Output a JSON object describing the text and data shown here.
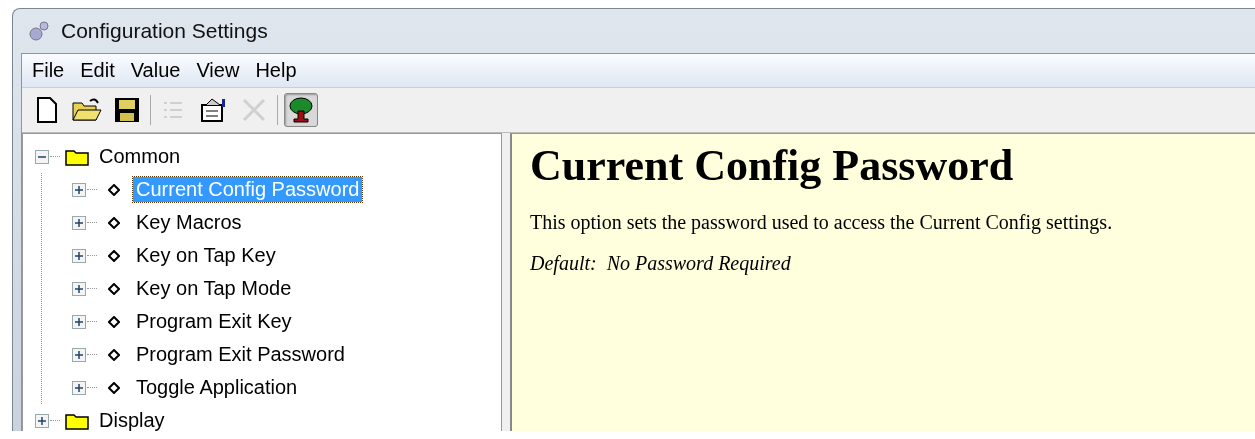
{
  "window": {
    "title": "Configuration Settings"
  },
  "menu": [
    "File",
    "Edit",
    "Value",
    "View",
    "Help"
  ],
  "toolbar": [
    {
      "kind": "new",
      "disabled": false,
      "pressed": false
    },
    {
      "kind": "open",
      "disabled": false,
      "pressed": false
    },
    {
      "kind": "save",
      "disabled": false,
      "pressed": false
    },
    {
      "kind": "separator"
    },
    {
      "kind": "list",
      "disabled": true,
      "pressed": false
    },
    {
      "kind": "properties",
      "disabled": false,
      "pressed": false
    },
    {
      "kind": "delete",
      "disabled": true,
      "pressed": false
    },
    {
      "kind": "separator"
    },
    {
      "kind": "tree",
      "disabled": false,
      "pressed": true
    }
  ],
  "tree": [
    {
      "label": "Common",
      "kind": "folder",
      "expanded": true,
      "selected": false,
      "children": [
        {
          "label": "Current Config Password",
          "kind": "setting",
          "expanded": false,
          "selected": true
        },
        {
          "label": "Key Macros",
          "kind": "setting",
          "expanded": false,
          "selected": false
        },
        {
          "label": "Key on Tap Key",
          "kind": "setting",
          "expanded": false,
          "selected": false
        },
        {
          "label": "Key on Tap Mode",
          "kind": "setting",
          "expanded": false,
          "selected": false
        },
        {
          "label": "Program Exit Key",
          "kind": "setting",
          "expanded": false,
          "selected": false
        },
        {
          "label": "Program Exit Password",
          "kind": "setting",
          "expanded": false,
          "selected": false
        },
        {
          "label": "Toggle Application",
          "kind": "setting",
          "expanded": false,
          "selected": false
        }
      ]
    },
    {
      "label": "Display",
      "kind": "folder",
      "expanded": false,
      "selected": false
    }
  ],
  "detail": {
    "heading": "Current Config Password",
    "description": "This option sets the password used to access the Current Config settings.",
    "default": "Default:  No Password Required"
  }
}
